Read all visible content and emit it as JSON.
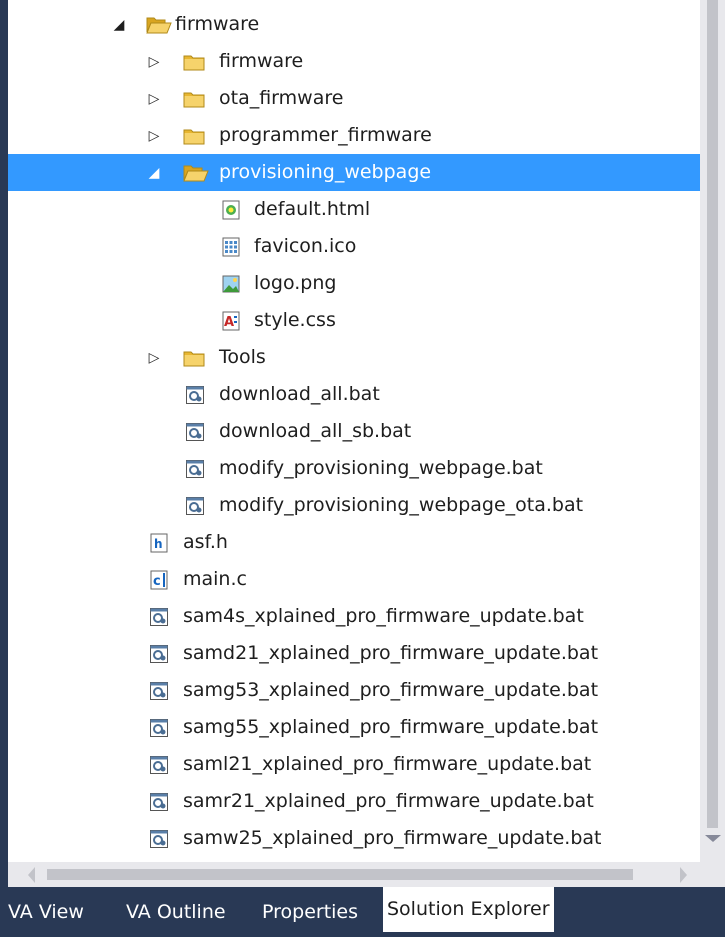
{
  "tree": {
    "rows": [
      {
        "label": "firmware",
        "type": "folder-open-icon",
        "expander": "expanded"
      },
      {
        "label": "firmware",
        "type": "folder-icon",
        "expander": "collapsed"
      },
      {
        "label": "ota_firmware",
        "type": "folder-icon",
        "expander": "collapsed"
      },
      {
        "label": "programmer_firmware",
        "type": "folder-icon",
        "expander": "collapsed"
      },
      {
        "label": "provisioning_webpage",
        "type": "folder-open-icon",
        "expander": "expanded",
        "selected": true
      },
      {
        "label": "default.html",
        "type": "html-file-icon",
        "expander": "none"
      },
      {
        "label": "favicon.ico",
        "type": "ico-file-icon",
        "expander": "none"
      },
      {
        "label": "logo.png",
        "type": "image-file-icon",
        "expander": "none"
      },
      {
        "label": "style.css",
        "type": "css-file-icon",
        "expander": "none"
      },
      {
        "label": "Tools",
        "type": "folder-icon",
        "expander": "collapsed"
      },
      {
        "label": "download_all.bat",
        "type": "bat-file-icon",
        "expander": "none"
      },
      {
        "label": "download_all_sb.bat",
        "type": "bat-file-icon",
        "expander": "none"
      },
      {
        "label": "modify_provisioning_webpage.bat",
        "type": "bat-file-icon",
        "expander": "none"
      },
      {
        "label": "modify_provisioning_webpage_ota.bat",
        "type": "bat-file-icon",
        "expander": "none"
      },
      {
        "label": "asf.h",
        "type": "header-file-icon",
        "expander": "none"
      },
      {
        "label": "main.c",
        "type": "c-file-icon",
        "expander": "none"
      },
      {
        "label": "sam4s_xplained_pro_firmware_update.bat",
        "type": "bat-file-icon",
        "expander": "none"
      },
      {
        "label": "samd21_xplained_pro_firmware_update.bat",
        "type": "bat-file-icon",
        "expander": "none"
      },
      {
        "label": "samg53_xplained_pro_firmware_update.bat",
        "type": "bat-file-icon",
        "expander": "none"
      },
      {
        "label": "samg55_xplained_pro_firmware_update.bat",
        "type": "bat-file-icon",
        "expander": "none"
      },
      {
        "label": "saml21_xplained_pro_firmware_update.bat",
        "type": "bat-file-icon",
        "expander": "none"
      },
      {
        "label": "samr21_xplained_pro_firmware_update.bat",
        "type": "bat-file-icon",
        "expander": "none"
      },
      {
        "label": "samw25_xplained_pro_firmware_update.bat",
        "type": "bat-file-icon",
        "expander": "none"
      }
    ]
  },
  "tabs": [
    {
      "label": "VA View",
      "active": false
    },
    {
      "label": "VA Outline",
      "active": false
    },
    {
      "label": "Properties",
      "active": false
    },
    {
      "label": "Solution Explorer",
      "active": true
    }
  ],
  "colors": {
    "selection": "#3399ff",
    "tab_bar": "#293955",
    "folder": "#e8b630"
  }
}
